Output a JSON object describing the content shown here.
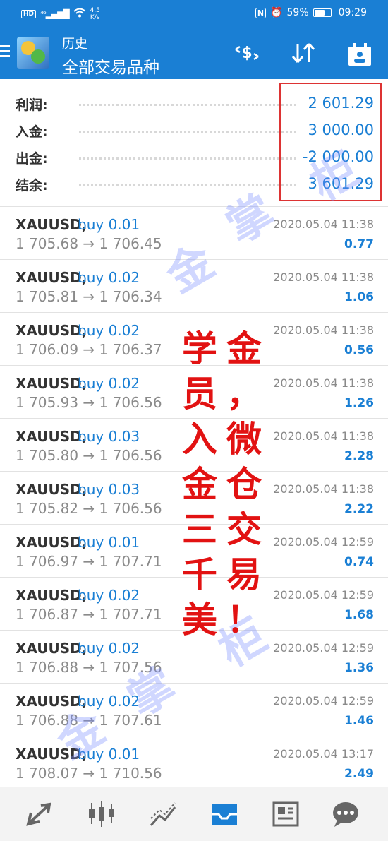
{
  "status_bar": {
    "hd": "HD",
    "network": "⁴⁶",
    "speed_value": "4.5",
    "speed_unit": "K/s",
    "nfc": "N",
    "battery": "59%",
    "time": "09:29"
  },
  "app_bar": {
    "title": "历史",
    "subtitle": "全部交易品种"
  },
  "summary": [
    {
      "label": "利润:",
      "value": "2 601.29"
    },
    {
      "label": "入金:",
      "value": "3 000.00"
    },
    {
      "label": "出金:",
      "value": "-2 000.00"
    },
    {
      "label": "结余:",
      "value": "3 601.29"
    }
  ],
  "deals": [
    {
      "symbol": "XAUUSD,",
      "side": "buy 0.01",
      "prices": "1 705.68 → 1 706.45",
      "time": "2020.05.04 11:38",
      "profit": "0.77"
    },
    {
      "symbol": "XAUUSD,",
      "side": "buy 0.02",
      "prices": "1 705.81 → 1 706.34",
      "time": "2020.05.04 11:38",
      "profit": "1.06"
    },
    {
      "symbol": "XAUUSD,",
      "side": "buy 0.02",
      "prices": "1 706.09 → 1 706.37",
      "time": "2020.05.04 11:38",
      "profit": "0.56"
    },
    {
      "symbol": "XAUUSD,",
      "side": "buy 0.02",
      "prices": "1 705.93 → 1 706.56",
      "time": "2020.05.04 11:38",
      "profit": "1.26"
    },
    {
      "symbol": "XAUUSD,",
      "side": "buy 0.03",
      "prices": "1 705.80 → 1 706.56",
      "time": "2020.05.04 11:38",
      "profit": "2.28"
    },
    {
      "symbol": "XAUUSD,",
      "side": "buy 0.03",
      "prices": "1 705.82 → 1 706.56",
      "time": "2020.05.04 11:38",
      "profit": "2.22"
    },
    {
      "symbol": "XAUUSD,",
      "side": "buy 0.01",
      "prices": "1 706.97 → 1 707.71",
      "time": "2020.05.04 12:59",
      "profit": "0.74"
    },
    {
      "symbol": "XAUUSD,",
      "side": "buy 0.02",
      "prices": "1 706.87 → 1 707.71",
      "time": "2020.05.04 12:59",
      "profit": "1.68"
    },
    {
      "symbol": "XAUUSD,",
      "side": "buy 0.02",
      "prices": "1 706.88 → 1 707.56",
      "time": "2020.05.04 12:59",
      "profit": "1.36"
    },
    {
      "symbol": "XAUUSD,",
      "side": "buy 0.02",
      "prices": "1 706.88 → 1 707.61",
      "time": "2020.05.04 12:59",
      "profit": "1.46"
    },
    {
      "symbol": "XAUUSD,",
      "side": "buy 0.01",
      "prices": "1 708.07 → 1 710.56",
      "time": "2020.05.04 13:17",
      "profit": "2.49"
    }
  ],
  "overlay": {
    "col1": [
      "学",
      "员",
      "入",
      "金",
      "三",
      "千",
      "美"
    ],
    "col2": [
      "金",
      "，",
      "微",
      "仓",
      "交",
      "易",
      "！"
    ]
  },
  "watermark": [
    "金",
    "掌",
    "柜"
  ],
  "colors": {
    "primary": "#1a7fd4",
    "overlay_red": "#e21212",
    "highlight_box": "#dd3333"
  },
  "bottom_nav": [
    "quotes-icon",
    "chart-icon",
    "trade-icon",
    "history-icon",
    "news-icon",
    "chat-icon"
  ]
}
